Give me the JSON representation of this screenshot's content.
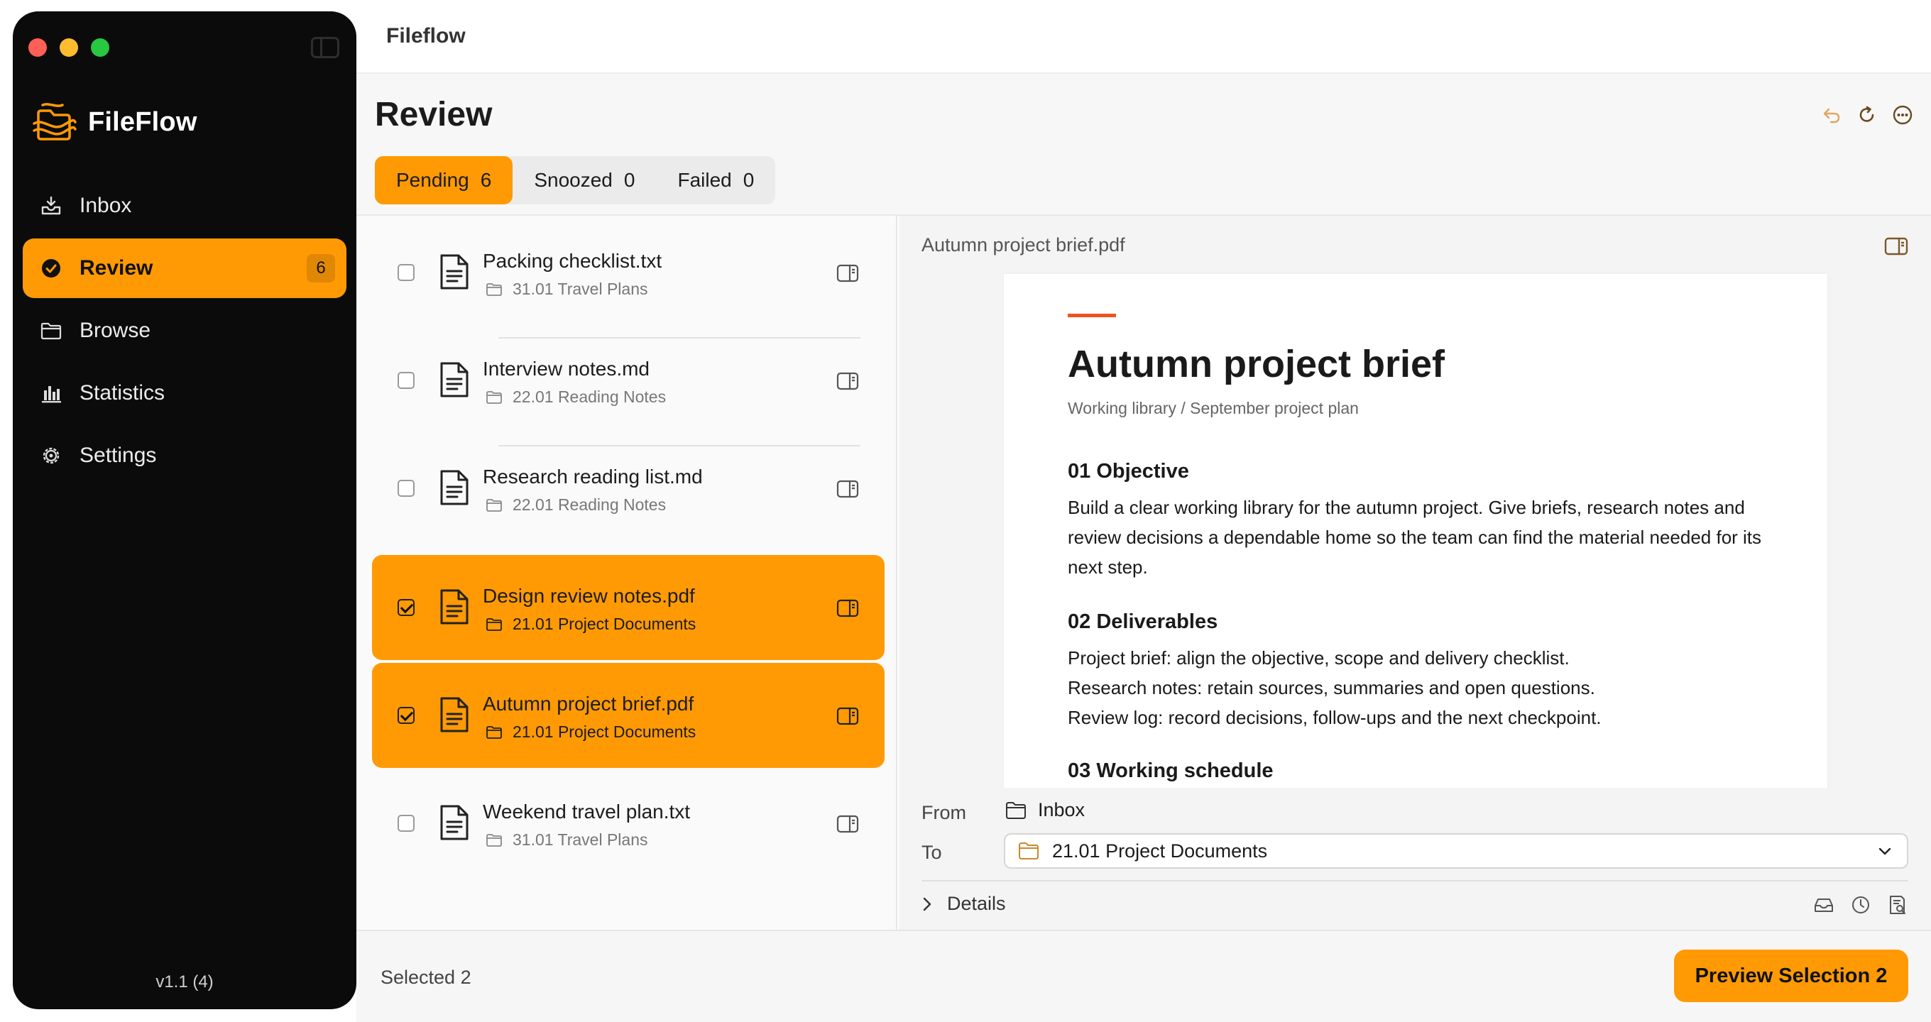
{
  "app": {
    "window_title": "Fileflow",
    "brand_name": "FileFlow",
    "version": "v1.1 (4)"
  },
  "colors": {
    "accent": "#ff9a05",
    "sidebar_bg": "#0b0b0b",
    "doc_accent": "#f0541e"
  },
  "sidebar": {
    "items": [
      {
        "label": "Inbox",
        "icon": "inbox-tray-icon"
      },
      {
        "label": "Review",
        "icon": "check-circle-icon",
        "badge": "6",
        "active": true
      },
      {
        "label": "Browse",
        "icon": "folder-icon"
      },
      {
        "label": "Statistics",
        "icon": "bar-chart-icon"
      },
      {
        "label": "Settings",
        "icon": "gear-icon"
      }
    ]
  },
  "header": {
    "title": "Review",
    "actions": [
      "undo-icon",
      "refresh-icon",
      "more-icon"
    ],
    "tabs": [
      {
        "label": "Pending",
        "count": "6",
        "active": true
      },
      {
        "label": "Snoozed",
        "count": "0"
      },
      {
        "label": "Failed",
        "count": "0"
      }
    ]
  },
  "files": [
    {
      "name": "Packing checklist.txt",
      "folder": "31.01 Travel Plans",
      "selected": false
    },
    {
      "name": "Interview notes.md",
      "folder": "22.01 Reading Notes",
      "selected": false
    },
    {
      "name": "Research reading list.md",
      "folder": "22.01 Reading Notes",
      "selected": false
    },
    {
      "name": "Design review notes.pdf",
      "folder": "21.01 Project Documents",
      "selected": true
    },
    {
      "name": "Autumn project brief.pdf",
      "folder": "21.01 Project Documents",
      "selected": true
    },
    {
      "name": "Weekend travel plan.txt",
      "folder": "31.01 Travel Plans",
      "selected": false
    }
  ],
  "preview": {
    "file_name": "Autumn project brief.pdf",
    "doc": {
      "title": "Autumn project brief",
      "subtitle": "Working library / September project plan",
      "s1_heading": "01  Objective",
      "s1_body": "Build a clear working library for the autumn project. Give briefs, research notes and review decisions a dependable home so the team can find the material needed for its next step.",
      "s2_heading": "02  Deliverables",
      "s2_line1": "Project brief: align the objective, scope and delivery checklist.",
      "s2_line2": "Research notes: retain sources, summaries and open questions.",
      "s2_line3": "Review log: record decisions, follow-ups and the next checkpoint.",
      "s3_heading": "03  Working schedule"
    }
  },
  "move": {
    "from_label": "From",
    "from_value": "Inbox",
    "to_label": "To",
    "to_value": "21.01 Project Documents",
    "details_label": "Details"
  },
  "footer": {
    "selected_text": "Selected 2",
    "primary_button": "Preview Selection 2"
  }
}
